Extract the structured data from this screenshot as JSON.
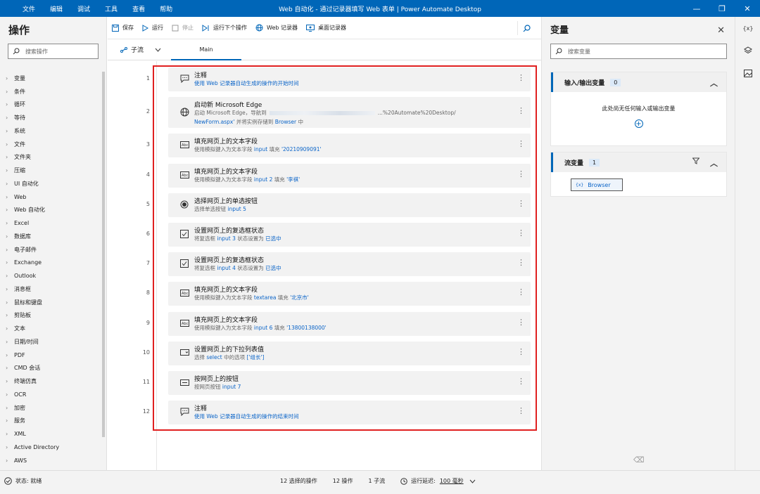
{
  "titlebar": {
    "menu": [
      "文件",
      "编辑",
      "调试",
      "工具",
      "查看",
      "帮助"
    ],
    "title": "Web 自动化 - 通过记录器填写 Web 表单 | Power Automate Desktop",
    "minimize": "—",
    "maximize": "❐",
    "close": "✕"
  },
  "actions_pane": {
    "title": "操作",
    "search_placeholder": "搜索操作",
    "categories": [
      "变量",
      "条件",
      "循环",
      "等待",
      "系统",
      "文件",
      "文件夹",
      "压缩",
      "UI 自动化",
      "Web",
      "Web 自动化",
      "Excel",
      "数据库",
      "电子邮件",
      "Exchange",
      "Outlook",
      "消息框",
      "鼠标和键盘",
      "剪贴板",
      "文本",
      "日期/时间",
      "PDF",
      "CMD 会话",
      "终端仿真",
      "OCR",
      "加密",
      "服务",
      "XML",
      "Active Directory",
      "AWS"
    ]
  },
  "toolbar": {
    "save": "保存",
    "run": "运行",
    "stop": "停止",
    "run_next": "运行下个操作",
    "web_recorder": "Web 记录器",
    "desktop_recorder": "桌面记录器"
  },
  "tabs": {
    "subflow": "子流",
    "main": "Main"
  },
  "flow": [
    {
      "num": "1",
      "title": "注释",
      "desc": "使用 Web 记录器自动生成的操作的开始时间",
      "icon": "comment"
    },
    {
      "num": "2",
      "title": "启动新 Microsoft Edge",
      "desc_a": "启动 Microsoft Edge，导航到",
      "desc_b": "...%20Automate%20Desktop/",
      "desc2_a": "NewForm.aspx'",
      "desc2_b": " 并将实例存储到 ",
      "desc2_c": "Browser",
      "desc2_d": " 中",
      "icon": "globe"
    },
    {
      "num": "3",
      "title": "填充网页上的文本字段",
      "desc_a": "使用模拟键入为文本字段 ",
      "desc_b": "input",
      "desc_c": " 填充 ",
      "desc_d": "'20210909091'",
      "icon": "textfield"
    },
    {
      "num": "4",
      "title": "填充网页上的文本字段",
      "desc_a": "使用模拟键入为文本字段 ",
      "desc_b": "input 2",
      "desc_c": " 填充 ",
      "desc_d": "'李祺'",
      "icon": "textfield"
    },
    {
      "num": "5",
      "title": "选择网页上的单选按钮",
      "desc_a": "选择单选按钮 ",
      "desc_b": "input 5",
      "icon": "radio"
    },
    {
      "num": "6",
      "title": "设置网页上的复选框状态",
      "desc_a": "将复选框 ",
      "desc_b": "input 3",
      "desc_c": " 状态设置为 ",
      "desc_d": "已选中",
      "icon": "checkbox"
    },
    {
      "num": "7",
      "title": "设置网页上的复选框状态",
      "desc_a": "将复选框 ",
      "desc_b": "input 4",
      "desc_c": " 状态设置为 ",
      "desc_d": "已选中",
      "icon": "checkbox"
    },
    {
      "num": "8",
      "title": "填充网页上的文本字段",
      "desc_a": "使用模拟键入为文本字段 ",
      "desc_b": "textarea",
      "desc_c": " 填充 ",
      "desc_d": "'北京市'",
      "icon": "textfield"
    },
    {
      "num": "9",
      "title": "填充网页上的文本字段",
      "desc_a": "使用模拟键入为文本字段 ",
      "desc_b": "input 6",
      "desc_c": " 填充 ",
      "desc_d": "'13800138000'",
      "icon": "textfield"
    },
    {
      "num": "10",
      "title": "设置网页上的下拉列表值",
      "desc_a": "选择 ",
      "desc_b": "select",
      "desc_c": " 中的选项 ",
      "desc_d": "['组长']",
      "icon": "dropdown"
    },
    {
      "num": "11",
      "title": "按网页上的按钮",
      "desc_a": "按网页按钮 ",
      "desc_b": "input 7",
      "icon": "button"
    },
    {
      "num": "12",
      "title": "注释",
      "desc": "使用 Web 记录器自动生成的操作的结束时间",
      "icon": "comment"
    }
  ],
  "variables_pane": {
    "title": "变量",
    "close": "✕",
    "search_placeholder": "搜索变量",
    "io_section": {
      "label": "输入/输出变量",
      "count": "0",
      "empty_text": "此处尚无任何输入或输出变量"
    },
    "flow_section": {
      "label": "流变量",
      "count": "1",
      "vars": [
        "Browser"
      ]
    }
  },
  "farright": {
    "var_icon": "{x}"
  },
  "statusbar": {
    "status": "状态: 就绪",
    "selected": "12 选择的操作",
    "actions": "12 操作",
    "subflows": "1 子流",
    "delay_label": "运行延迟:",
    "delay_value": "100 毫秒"
  },
  "colors": {
    "accent": "#0066b8",
    "highlight_border": "#e02020",
    "link": "#0a64c8"
  }
}
